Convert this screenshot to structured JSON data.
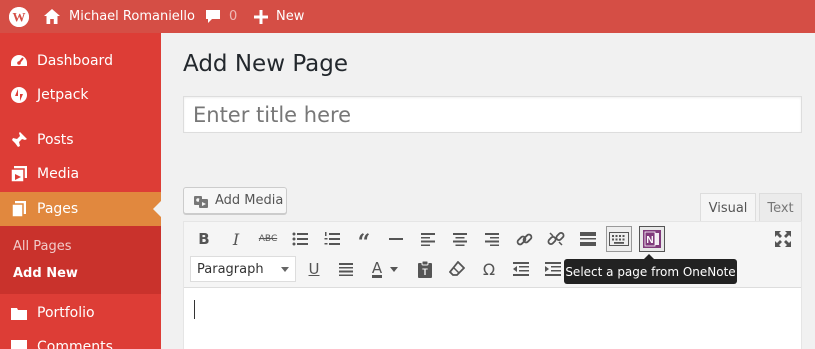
{
  "admin_bar": {
    "site_name": "Michael Romaniello",
    "comments_count": "0",
    "new_label": "New",
    "bar_color": "#d54e45"
  },
  "sidebar": {
    "menu_color": "#dd3d36",
    "current_color": "#e1883e",
    "items": [
      {
        "label": "Dashboard",
        "icon": "dashboard-icon"
      },
      {
        "label": "Jetpack",
        "icon": "jetpack-icon"
      },
      {
        "label": "Posts",
        "icon": "pin-icon"
      },
      {
        "label": "Media",
        "icon": "media-icon"
      },
      {
        "label": "Pages",
        "icon": "pages-icon",
        "current": true
      },
      {
        "label": "Portfolio",
        "icon": "portfolio-icon"
      },
      {
        "label": "Comments",
        "icon": "comments-icon"
      }
    ],
    "submenu": [
      {
        "label": "All Pages"
      },
      {
        "label": "Add New",
        "current": true
      }
    ]
  },
  "main": {
    "page_title": "Add New Page",
    "title_placeholder": "Enter title here",
    "add_media_label": "Add Media",
    "tabs": [
      {
        "label": "Visual",
        "active": true
      },
      {
        "label": "Text",
        "active": false
      }
    ],
    "format_select_value": "Paragraph",
    "tooltip": "Select a page from OneNote"
  },
  "toolbar": {
    "row1": [
      "bold-icon",
      "italic-icon",
      "strikethrough-icon",
      "bullet-list-icon",
      "numbered-list-icon",
      "blockquote-icon",
      "horizontal-line-icon",
      "align-left-icon",
      "align-center-icon",
      "align-right-icon",
      "insert-link-icon",
      "remove-link-icon",
      "read-more-icon",
      "toolbar-toggle-icon",
      "onenote-icon",
      "fullscreen-icon"
    ],
    "row2": [
      "underline-icon",
      "justify-icon",
      "text-color-icon",
      "paste-text-icon",
      "clear-formatting-icon",
      "special-character-icon",
      "outdent-icon",
      "indent-icon"
    ],
    "onenote_color": "#80397b"
  }
}
